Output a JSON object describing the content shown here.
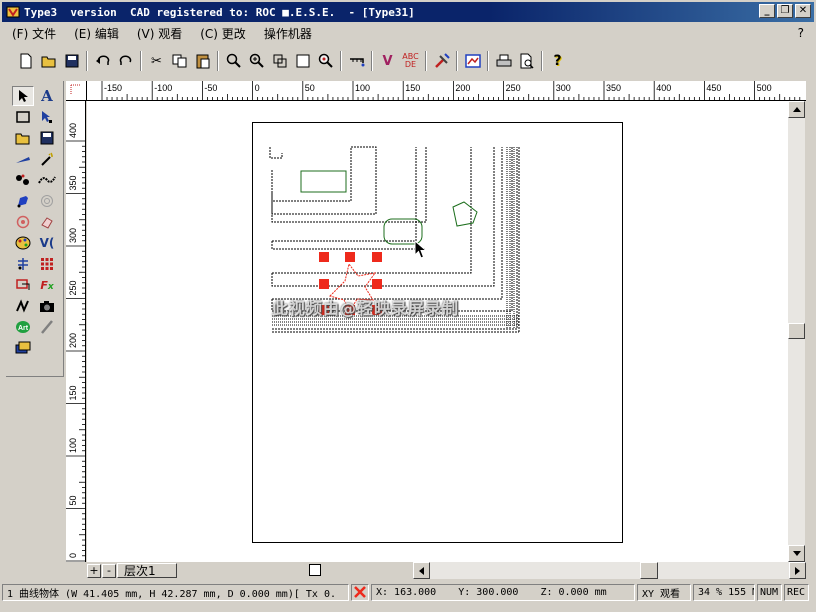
{
  "window": {
    "title": "Type3  version  CAD registered to: ROC ■.E.S.E.  - [Type31]",
    "minimize": "_",
    "restore": "❐",
    "close": "✕"
  },
  "menu": {
    "items": [
      "(F) 文件",
      "(E) 编辑",
      "(V) 观看",
      "(C) 更改",
      "操作机器"
    ],
    "help": "?"
  },
  "toolbar": {
    "icons": [
      "new-icon",
      "open-icon",
      "save-icon",
      "undo-icon",
      "redo-icon",
      "cut-icon",
      "copy-icon",
      "paste-icon",
      "zoom-icon",
      "zoom-in-icon",
      "zoom-window-icon",
      "zoom-page-icon",
      "zoom-fit-icon",
      "measure-icon",
      "text-v-icon",
      "spell-icon",
      "tools-icon",
      "image-icon",
      "print-icon",
      "print-preview-icon",
      "help-icon"
    ]
  },
  "ruler": {
    "horizontal_labels": [
      "-150",
      "-100",
      "-50",
      "0",
      "50",
      "100",
      "150",
      "200",
      "250",
      "300",
      "350",
      "400",
      "450",
      "500"
    ],
    "vertical_labels": [
      "400",
      "350",
      "300",
      "250",
      "200",
      "150",
      "100",
      "50",
      "0"
    ]
  },
  "layer": {
    "add": "+",
    "remove": "-",
    "name": "层次1"
  },
  "status": {
    "object": "1 曲线物体  (W 41.405 mm, H 42.287 mm, D 0.000 mm)[ Tx 0.",
    "x": "X: 163.000",
    "y": "Y: 300.000",
    "z": "Z: 0.000 mm",
    "view": "XY 观看",
    "zoom": "34 % 155 M",
    "num": "NUM",
    "rec": "REC"
  },
  "watermark": "此视频由@轻映录屏录制",
  "colors": {
    "titlebar": "#0a246a",
    "face": "#d4d0c8",
    "marker": "#ee2a1c",
    "shape_green": "#1c6e1c"
  }
}
